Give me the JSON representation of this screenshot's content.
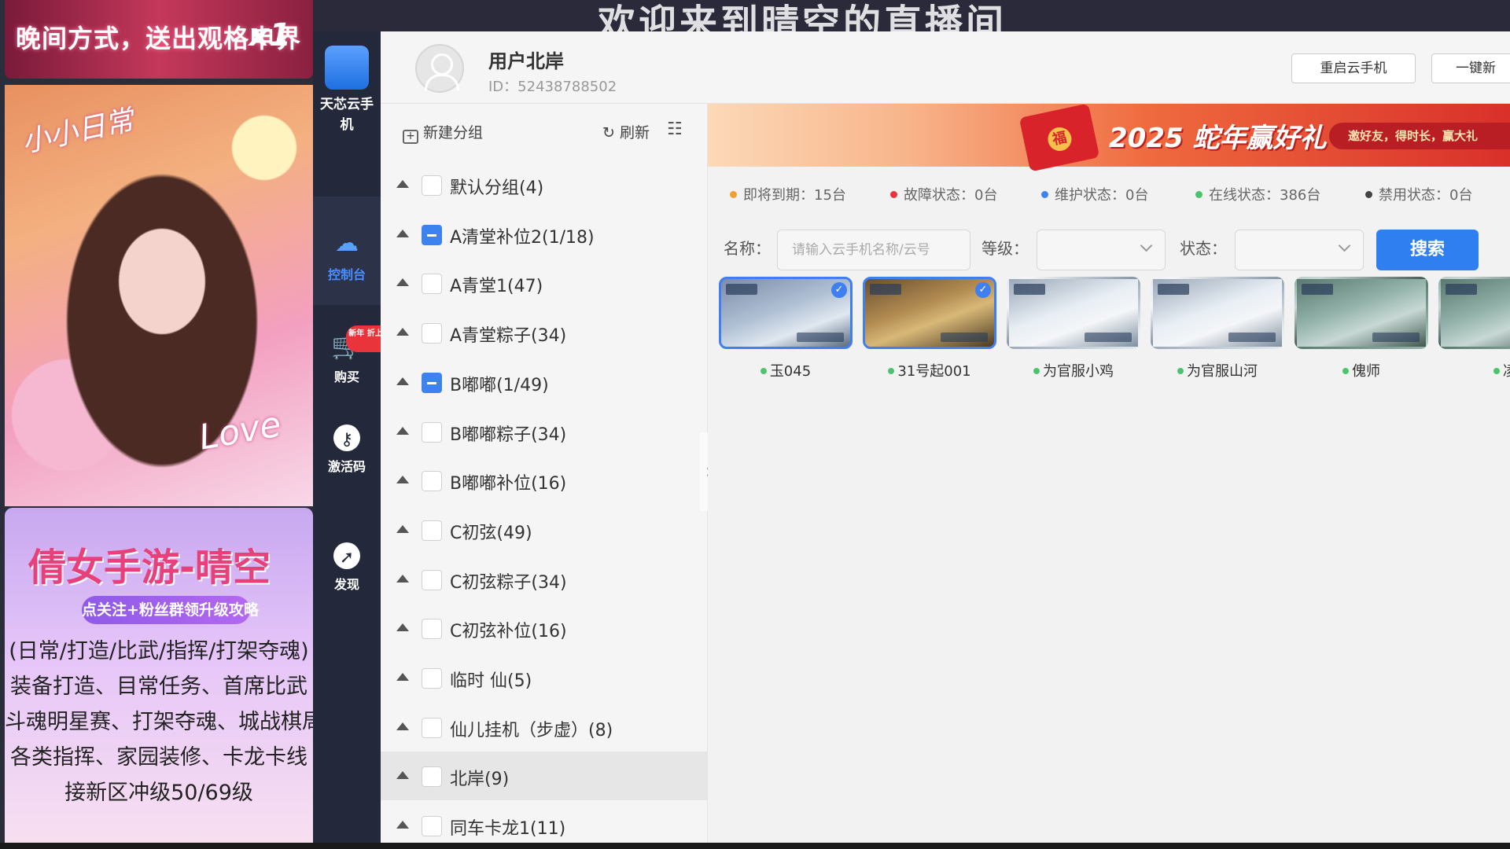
{
  "stream": {
    "topbar_text": "晚间方式，送出观格申界",
    "topbar_count": "x1",
    "sticker_1": "小小日常",
    "sticker_2": "Love",
    "promo_title": "倩女手游-晴空",
    "promo_badge": "点关注+粉丝群领升级攻略",
    "promo_lines": [
      "(日常/打造/比武/指挥/打架夺魂)",
      "装备打造、目常任务、首席比武",
      "斗魂明星赛、打架夺魂、城战棋局",
      "各类指挥、家园装修、卡龙卡线",
      "接新区冲级50/69级"
    ]
  },
  "window": {
    "bg_title": "欢迎来到晴空的直播间"
  },
  "nav": {
    "logo_label": "天芯云手机",
    "console_label": "控制台",
    "buy_label": "购买",
    "buy_badge": "新年 折上折",
    "activate_label": "激活码",
    "discover_label": "发现"
  },
  "header": {
    "user_name": "用户北岸",
    "user_id": "ID：52438788502",
    "restart_label": "重启云手机",
    "one_click_label": "一键新"
  },
  "sidebar": {
    "new_group_label": "新建分组",
    "refresh_label": "刷新",
    "groups": [
      {
        "label": "默认分组(4)",
        "state": "none"
      },
      {
        "label": "A清堂补位2(1/18)",
        "state": "partial"
      },
      {
        "label": "A青堂1(47)",
        "state": "none"
      },
      {
        "label": "A青堂粽子(34)",
        "state": "none"
      },
      {
        "label": "B嘟嘟(1/49)",
        "state": "partial"
      },
      {
        "label": "B嘟嘟粽子(34)",
        "state": "none"
      },
      {
        "label": "B嘟嘟补位(16)",
        "state": "none"
      },
      {
        "label": "C初弦(49)",
        "state": "none"
      },
      {
        "label": "C初弦粽子(34)",
        "state": "none"
      },
      {
        "label": "C初弦补位(16)",
        "state": "none"
      },
      {
        "label": "临时 仙(5)",
        "state": "none"
      },
      {
        "label": "仙儿挂机（步虚）(8)",
        "state": "none"
      },
      {
        "label": "北岸(9)",
        "state": "none",
        "active": true
      },
      {
        "label": "同车卡龙1(11)",
        "state": "none"
      }
    ]
  },
  "banner": {
    "headline": "2025 蛇年赢好礼",
    "tagline": "邀好友，得时长，赢大礼"
  },
  "status": {
    "expiring": "即将到期：15台",
    "fault": "故障状态：0台",
    "maintenance": "维护状态：0台",
    "online": "在线状态：386台",
    "banned": "禁用状态：0台",
    "colors": {
      "expiring": "#f0a030",
      "fault": "#e8343a",
      "maintenance": "#3d83f0",
      "online": "#4cc46e",
      "banned": "#444444"
    }
  },
  "search": {
    "name_label": "名称：",
    "name_placeholder": "请输入云手机名称/云号",
    "level_label": "等级：",
    "state_label": "状态：",
    "search_button": "搜索"
  },
  "devices": [
    {
      "name": "玉045",
      "selected": true
    },
    {
      "name": "31号起001",
      "selected": true
    },
    {
      "name": "为官服小鸡",
      "selected": false
    },
    {
      "name": "为官服山河",
      "selected": false
    },
    {
      "name": "傀师",
      "selected": false
    },
    {
      "name": "凌",
      "selected": false
    }
  ],
  "icons": {
    "collapse": "chevron-right-icon",
    "caret": "caret-up-icon"
  }
}
